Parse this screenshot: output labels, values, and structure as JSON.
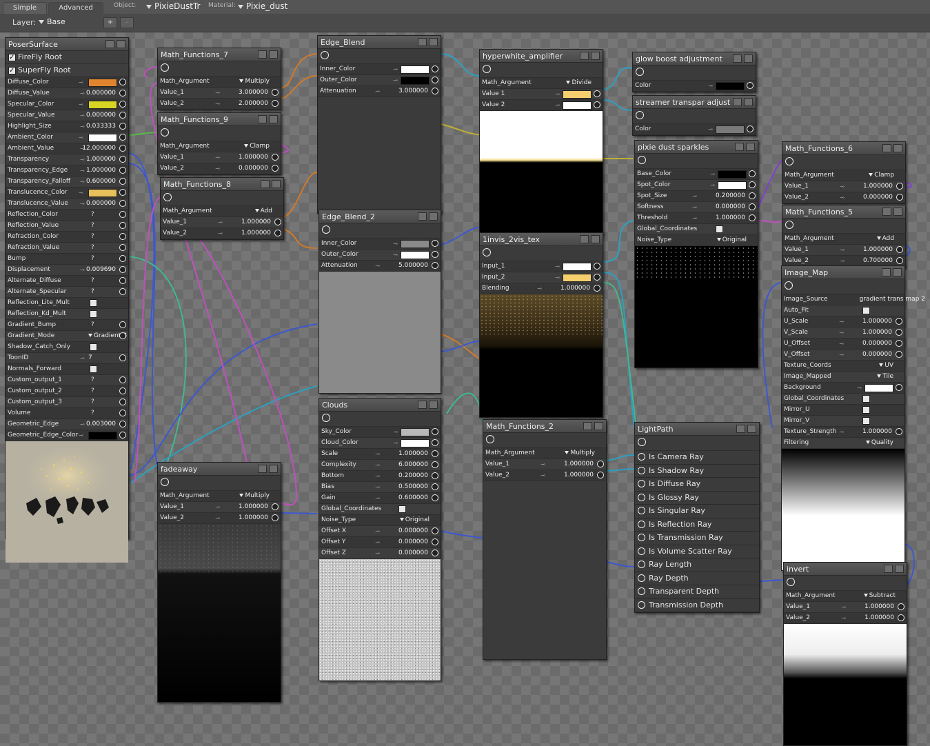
{
  "toolbar": {
    "tabs": [
      "Simple",
      "Advanced"
    ],
    "object_label": "Object:",
    "object_value": "PixieDustTr",
    "material_label": "Material:",
    "material_value": "Pixie_dust",
    "layer_label": "Layer:",
    "layer_value": "Base",
    "add_label": "+",
    "remove_label": "-"
  },
  "poser": {
    "title": "PoserSurface",
    "roots": [
      "FireFly Root",
      "SuperFly Root"
    ],
    "rows": [
      {
        "label": "Diffuse_Color",
        "type": "swatch",
        "color": "#e0852e"
      },
      {
        "label": "Diffuse_Value",
        "type": "num",
        "value": "0.000000"
      },
      {
        "label": "Specular_Color",
        "type": "swatch",
        "color": "#d8d424"
      },
      {
        "label": "Specular_Value",
        "type": "num",
        "value": "0.000000"
      },
      {
        "label": "Highlight_Size",
        "type": "num",
        "value": "0.033333"
      },
      {
        "label": "Ambient_Color",
        "type": "swatch",
        "color": "#ffffff"
      },
      {
        "label": "Ambient_Value",
        "type": "num",
        "value": "12.000000"
      },
      {
        "label": "Transparency",
        "type": "num",
        "value": "1.000000"
      },
      {
        "label": "Transparency_Edge",
        "type": "num",
        "value": "1.000000"
      },
      {
        "label": "Transparency_Falloff",
        "type": "num",
        "value": "0.600000"
      },
      {
        "label": "Translucence_Color",
        "type": "swatch",
        "color": "#e8c05a"
      },
      {
        "label": "Translucence_Value",
        "type": "num",
        "value": "0.000000"
      },
      {
        "label": "Reflection_Color",
        "type": "q"
      },
      {
        "label": "Reflection_Value",
        "type": "q"
      },
      {
        "label": "Refraction_Color",
        "type": "q"
      },
      {
        "label": "Refraction_Value",
        "type": "q"
      },
      {
        "label": "Bump",
        "type": "q"
      },
      {
        "label": "Displacement",
        "type": "num",
        "value": "0.009690"
      },
      {
        "label": "Alternate_Diffuse",
        "type": "q"
      },
      {
        "label": "Alternate_Specular",
        "type": "q"
      },
      {
        "label": "Reflection_Lite_Mult",
        "type": "chk"
      },
      {
        "label": "Reflection_Kd_Mult",
        "type": "chk"
      },
      {
        "label": "Gradient_Bump",
        "type": "q"
      },
      {
        "label": "Gradient_Mode",
        "type": "dd",
        "value": "Gradient B"
      },
      {
        "label": "Shadow_Catch_Only",
        "type": "chk"
      },
      {
        "label": "ToonID",
        "type": "int",
        "value": "7"
      },
      {
        "label": "Normals_Forward",
        "type": "chk"
      },
      {
        "label": "Custom_output_1",
        "type": "q"
      },
      {
        "label": "Custom_output_2",
        "type": "q"
      },
      {
        "label": "Custom_output_3",
        "type": "q"
      },
      {
        "label": "Volume",
        "type": "q"
      },
      {
        "label": "Geometric_Edge",
        "type": "num",
        "value": "0.003000"
      },
      {
        "label": "Geometric_Edge_Color",
        "type": "swatch",
        "color": "#000000"
      }
    ]
  },
  "nodes": {
    "mf7": {
      "title": "Math_Functions_7",
      "rows": [
        {
          "label": "Math_Argument",
          "dd": "Multiply"
        },
        {
          "label": "Value_1",
          "value": "3.000000"
        },
        {
          "label": "Value_2",
          "value": "2.000000"
        }
      ]
    },
    "mf9": {
      "title": "Math_Functions_9",
      "rows": [
        {
          "label": "Math_Argument",
          "dd": "Clamp"
        },
        {
          "label": "Value_1",
          "value": "1.000000"
        },
        {
          "label": "Value_2",
          "value": "0.000000"
        }
      ]
    },
    "mf8": {
      "title": "Math_Functions_8",
      "rows": [
        {
          "label": "Math_Argument",
          "dd": "Add"
        },
        {
          "label": "Value_1",
          "value": "1.000000"
        },
        {
          "label": "Value_2",
          "value": "1.000000"
        }
      ]
    },
    "fadeaway": {
      "title": "fadeaway",
      "rows": [
        {
          "label": "Math_Argument",
          "dd": "Multiply"
        },
        {
          "label": "Value_1",
          "value": "1.000000"
        },
        {
          "label": "Value_2",
          "value": "1.000000"
        }
      ]
    },
    "eb1": {
      "title": "Edge_Blend",
      "rows": [
        {
          "label": "Inner_Color",
          "color": "#ffffff"
        },
        {
          "label": "Outer_Color",
          "color": "#000000"
        },
        {
          "label": "Attenuation",
          "value": "3.000000"
        }
      ]
    },
    "eb2": {
      "title": "Edge_Blend_2",
      "rows": [
        {
          "label": "Inner_Color",
          "color": "#8a8a8a"
        },
        {
          "label": "Outer_Color",
          "color": "#ffffff"
        },
        {
          "label": "Attenuation",
          "value": "5.000000"
        }
      ]
    },
    "clouds": {
      "title": "Clouds",
      "rows": [
        {
          "label": "Sky_Color",
          "color": "#b8b8b8"
        },
        {
          "label": "Cloud_Color",
          "color": "#ffffff"
        },
        {
          "label": "Scale",
          "value": "1.000000"
        },
        {
          "label": "Complexity",
          "value": "6.000000"
        },
        {
          "label": "Bottom",
          "value": "0.200000"
        },
        {
          "label": "Bias",
          "value": "0.500000"
        },
        {
          "label": "Gain",
          "value": "0.600000"
        },
        {
          "label": "Global_Coordinates",
          "chk": true
        },
        {
          "label": "Noise_Type",
          "dd": "Original"
        },
        {
          "label": "Offset X",
          "value": "0.000000"
        },
        {
          "label": "Offset Y",
          "value": "0.000000"
        },
        {
          "label": "Offset Z",
          "value": "0.000000"
        }
      ]
    },
    "hw": {
      "title": "hyperwhite_amplifier",
      "rows": [
        {
          "label": "Math_Argument",
          "dd": "Divide"
        },
        {
          "label": "Value 1",
          "color": "#f5cf6e"
        },
        {
          "label": "Value 2",
          "color": "#ffffff"
        }
      ]
    },
    "inv2": {
      "title": "1invis_2vis_tex",
      "rows": [
        {
          "label": "Input_1",
          "color": "#ffffff"
        },
        {
          "label": "Input_2",
          "color": "#f5cf6e"
        },
        {
          "label": "Blending",
          "value": "1.000000"
        }
      ]
    },
    "mf2": {
      "title": "Math_Functions_2",
      "rows": [
        {
          "label": "Math_Argument",
          "dd": "Multiply"
        },
        {
          "label": "Value_1",
          "value": "1.000000"
        },
        {
          "label": "Value_2",
          "value": "1.000000"
        }
      ]
    },
    "glow": {
      "title": "glow boost adjustment",
      "rows": [
        {
          "label": "Color",
          "color": "#000000"
        }
      ]
    },
    "streamer": {
      "title": "streamer transpar adjust",
      "rows": [
        {
          "label": "Color",
          "color": "#7a7a7a"
        }
      ]
    },
    "pixie": {
      "title": "pixie dust sparkles",
      "rows": [
        {
          "label": "Base_Color",
          "color": "#000000"
        },
        {
          "label": "Spot_Color",
          "color": "#ffffff"
        },
        {
          "label": "Spot_Size",
          "value": "0.200000"
        },
        {
          "label": "Softness",
          "value": "0.000000"
        },
        {
          "label": "Threshold",
          "value": "1.000000"
        },
        {
          "label": "Global_Coordinates",
          "chk": true
        },
        {
          "label": "Noise_Type",
          "dd": "Original"
        }
      ]
    },
    "lightpath": {
      "title": "LightPath",
      "items": [
        "Is Camera Ray",
        "Is Shadow Ray",
        "Is Diffuse Ray",
        "Is Glossy Ray",
        "Is Singular Ray",
        "Is Reflection Ray",
        "Is Transmission Ray",
        "Is Volume Scatter Ray",
        "Ray Length",
        "Ray Depth",
        "Transparent Depth",
        "Transmission Depth"
      ]
    },
    "mf6": {
      "title": "Math_Functions_6",
      "rows": [
        {
          "label": "Math_Argument",
          "dd": "Clamp"
        },
        {
          "label": "Value_1",
          "value": "1.000000"
        },
        {
          "label": "Value_2",
          "value": "0.000000"
        }
      ]
    },
    "mf5": {
      "title": "Math_Functions_5",
      "rows": [
        {
          "label": "Math_Argument",
          "dd": "Add"
        },
        {
          "label": "Value_1",
          "value": "1.000000"
        },
        {
          "label": "Value_2",
          "value": "0.700000"
        }
      ]
    },
    "imagemap": {
      "title": "Image_Map",
      "rows": [
        {
          "label": "Image_Source",
          "text": "gradient trans map 2"
        },
        {
          "label": "Auto_Fit",
          "chk": true
        },
        {
          "label": "U_Scale",
          "value": "1.000000"
        },
        {
          "label": "V_Scale",
          "value": "1.000000"
        },
        {
          "label": "U_Offset",
          "value": "0.000000"
        },
        {
          "label": "V_Offset",
          "value": "0.000000"
        },
        {
          "label": "Texture_Coords",
          "dd": "UV"
        },
        {
          "label": "Image_Mapped",
          "dd": "Tile"
        },
        {
          "label": "Background",
          "color": "#ffffff"
        },
        {
          "label": "Global_Coordinates",
          "chk": true
        },
        {
          "label": "Mirror_U",
          "chk": true
        },
        {
          "label": "Mirror_V",
          "chk": true
        },
        {
          "label": "Texture_Strength",
          "value": "1.000000"
        },
        {
          "label": "Filtering",
          "dd": "Quality"
        }
      ]
    },
    "invert": {
      "title": "invert",
      "rows": [
        {
          "label": "Math_Argument",
          "dd": "Subtract"
        },
        {
          "label": "Value_1",
          "value": "1.000000"
        },
        {
          "label": "Value_2",
          "value": "1.000000"
        }
      ]
    }
  }
}
